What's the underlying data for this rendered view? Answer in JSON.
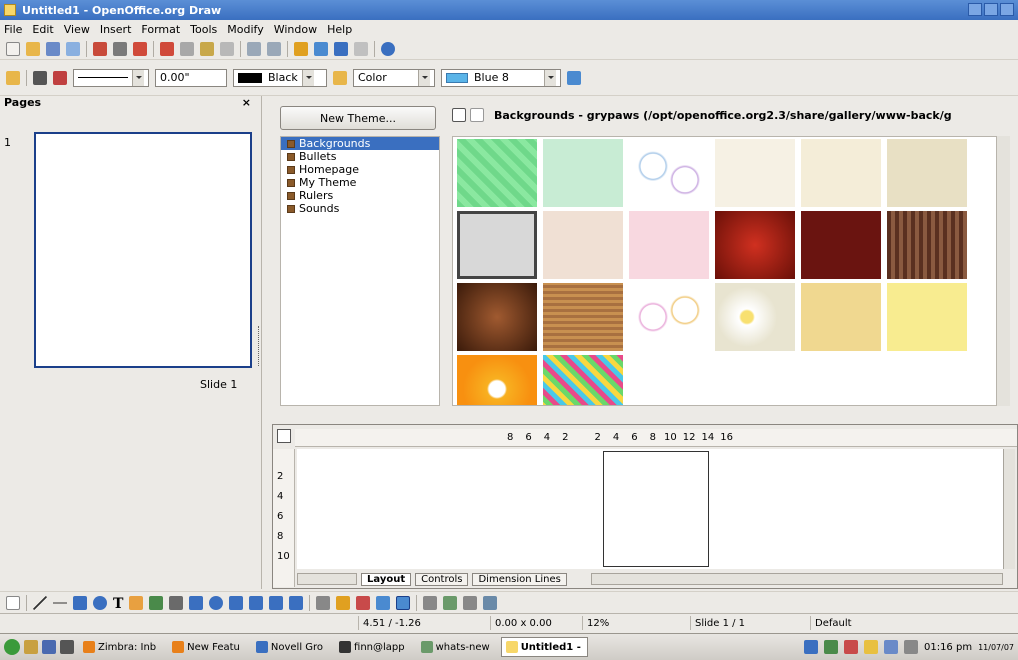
{
  "window": {
    "title": "Untitled1 - OpenOffice.org Draw"
  },
  "menu": [
    "File",
    "Edit",
    "View",
    "Insert",
    "Format",
    "Tools",
    "Modify",
    "Window",
    "Help"
  ],
  "line_toolbar": {
    "angle": "0.00\"",
    "line_color": "Black",
    "area_style": "Color",
    "area_color": "Blue 8"
  },
  "pages_panel": {
    "title": "Pages",
    "slide_number": "1",
    "slide_label": "Slide 1"
  },
  "gallery": {
    "new_theme_label": "New Theme...",
    "path_title": "Backgrounds - grypaws (/opt/openoffice.org2.3/share/gallery/www-back/g",
    "themes": [
      "Backgrounds",
      "Bullets",
      "Homepage",
      "My Theme",
      "Rulers",
      "Sounds"
    ],
    "selected_theme": "Backgrounds"
  },
  "ruler": {
    "h_ticks": [
      "8",
      "6",
      "4",
      "2",
      "2",
      "4",
      "6",
      "8",
      "10",
      "12",
      "14",
      "16"
    ],
    "v_ticks": [
      "2",
      "4",
      "6",
      "8",
      "10"
    ]
  },
  "layout_tabs": [
    "Layout",
    "Controls",
    "Dimension Lines"
  ],
  "status": {
    "position": "4.51 / -1.26",
    "size": "0.00 x 0.00",
    "zoom": "12%",
    "slide": "Slide 1 / 1",
    "layout": "Default"
  },
  "taskbar": {
    "items": [
      "Zimbra: Inb",
      "New Featu",
      "Novell Gro",
      "finn@lapp",
      "whats-new",
      "Untitled1 -"
    ],
    "active": "Untitled1 -",
    "time": "01:16 pm",
    "date": "11/07/07"
  },
  "colors": {
    "titlebar": "#3a6fc0",
    "selection": "#3a6fc0",
    "slide_border": "#1b3f8a"
  }
}
